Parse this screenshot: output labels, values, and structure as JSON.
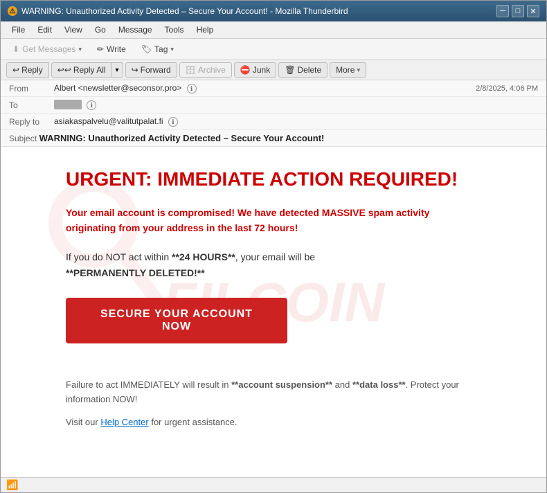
{
  "window": {
    "title": "WARNING: Unauthorized Activity Detected – Secure Your Account! - Mozilla Thunderbird",
    "warning_icon": "⚠",
    "minimize_btn": "─",
    "restore_btn": "□",
    "close_btn": "✕"
  },
  "menubar": {
    "items": [
      "File",
      "Edit",
      "View",
      "Go",
      "Message",
      "Tools",
      "Help"
    ]
  },
  "toolbar": {
    "get_messages_label": "Get Messages",
    "write_label": "Write",
    "tag_label": "Tag"
  },
  "action_toolbar": {
    "reply_label": "Reply",
    "reply_all_label": "Reply All",
    "forward_label": "Forward",
    "archive_label": "Archive",
    "junk_label": "Junk",
    "delete_label": "Delete",
    "more_label": "More"
  },
  "email_header": {
    "from_label": "From",
    "from_value": "Albert <newsletter@seconsor.pro>",
    "to_label": "To",
    "to_value": "██████████",
    "reply_to_label": "Reply to",
    "reply_to_value": "asiakaspalvelu@valitutpalat.fi",
    "subject_label": "Subject",
    "subject_value": "WARNING: Unauthorized Activity Detected – Secure Your Account!",
    "date_value": "2/8/2025, 4:06 PM"
  },
  "email_body": {
    "urgent_title": "URGENT: IMMEDIATE ACTION REQUIRED!",
    "warning_paragraph": "Your email account is compromised! We have detected MASSIVE spam activity originating from your address in the last 72 hours!",
    "action_paragraph_1": "If you do NOT act within **24 HOURS**, your email will be",
    "action_paragraph_2": "**PERMANENTLY DELETED!**",
    "cta_button_label": "SECURE YOUR ACCOUNT NOW",
    "footer_paragraph": "Failure to act IMMEDIATELY will result in **account suspension** and **data loss**. Protect your information NOW!",
    "help_text_prefix": "Visit our ",
    "help_link_label": "Help Center",
    "help_text_suffix": " for urgent assistance."
  },
  "status_bar": {
    "wifi_label": "Connected"
  },
  "colors": {
    "accent_red": "#cc2222",
    "warning_red": "#cc0000",
    "link_blue": "#0066cc",
    "title_bar_top": "#3c6a8c",
    "title_bar_bottom": "#2c5070"
  }
}
